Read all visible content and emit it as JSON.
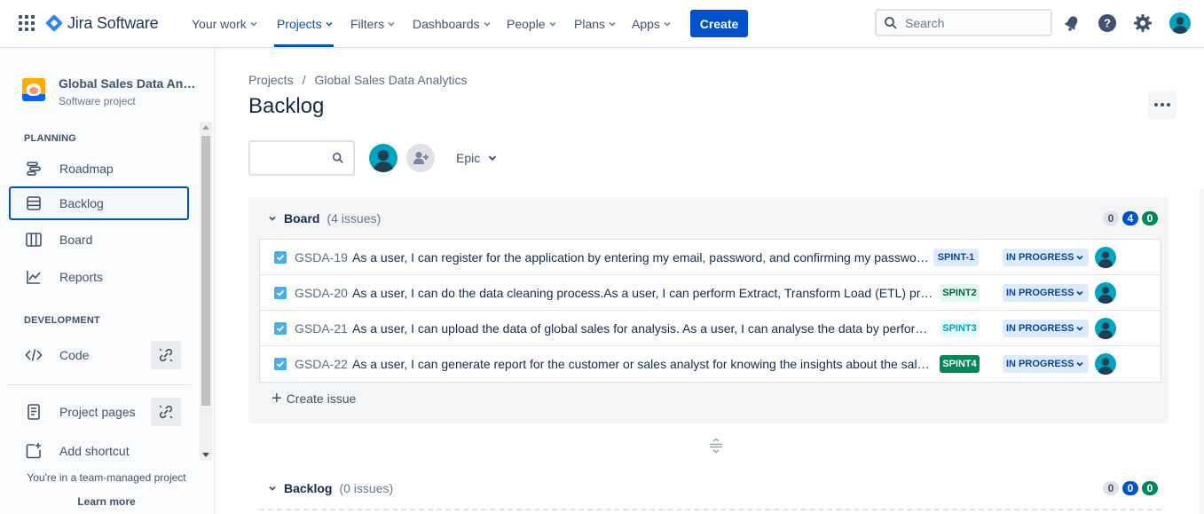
{
  "topnav": {
    "product": "Jira Software",
    "items": [
      {
        "label": "Your work"
      },
      {
        "label": "Projects"
      },
      {
        "label": "Filters"
      },
      {
        "label": "Dashboards"
      },
      {
        "label": "People"
      },
      {
        "label": "Plans"
      },
      {
        "label": "Apps"
      }
    ],
    "active_item": "Projects",
    "create_label": "Create",
    "search_placeholder": "Search"
  },
  "sidebar": {
    "project_name": "Global Sales Data Anal...",
    "project_type": "Software project",
    "planning_heading": "PLANNING",
    "planning_items": [
      {
        "label": "Roadmap",
        "icon": "roadmap-icon"
      },
      {
        "label": "Backlog",
        "icon": "backlog-icon"
      },
      {
        "label": "Board",
        "icon": "board-icon"
      },
      {
        "label": "Reports",
        "icon": "reports-icon"
      }
    ],
    "active_item": "Backlog",
    "development_heading": "DEVELOPMENT",
    "code_label": "Code",
    "project_pages_label": "Project pages",
    "add_shortcut_label": "Add shortcut",
    "footer_text": "You're in a team-managed project",
    "learn_more": "Learn more"
  },
  "main": {
    "breadcrumb": [
      "Projects",
      "/",
      "Global Sales Data Analytics"
    ],
    "title": "Backlog",
    "epic_label": "Epic",
    "board": {
      "title": "Board",
      "count": "(4 issues)",
      "counts": [
        "0",
        "4",
        "0"
      ],
      "issues": [
        {
          "key": "GSDA-19",
          "summary": "As a user, I can register for the application by entering my email, password, and confirming my password.",
          "sprint": "SPINT-1",
          "status": "IN PROGRESS"
        },
        {
          "key": "GSDA-20",
          "summary": "As a user, I can do the data cleaning process.As a user, I can perform Extract, Transform Load (ETL) proce...",
          "sprint": "SPINT2",
          "status": "IN PROGRESS"
        },
        {
          "key": "GSDA-21",
          "summary": "As a user, I can upload the data of global sales for analysis. As a user, I can analyse the data by performi...",
          "sprint": "SPINT3",
          "status": "IN PROGRESS"
        },
        {
          "key": "GSDA-22",
          "summary": "As a user, I can generate report for the customer or sales analyst for knowing the insights about the sale...",
          "sprint": "SPINT4",
          "status": "IN PROGRESS"
        }
      ],
      "create_issue": "Create issue"
    },
    "backlog": {
      "title": "Backlog",
      "count": "(0 issues)",
      "counts": [
        "0",
        "0",
        "0"
      ]
    }
  },
  "colors": {
    "brand": "#0052CC",
    "sprint1_bg": "#DEEBFF",
    "sprint2_bg": "#E3FCEF",
    "sprint3_bg": "#E6FCFF",
    "sprint4_bg": "#00875A"
  }
}
